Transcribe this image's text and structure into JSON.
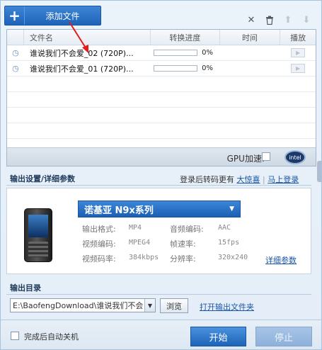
{
  "toolbar": {
    "add_file_label": "添加文件",
    "icons": [
      "close-icon",
      "trash-icon",
      "arrow-up-icon",
      "arrow-down-icon"
    ]
  },
  "file_list": {
    "headers": [
      "文件名",
      "转换进度",
      "时间",
      "播放"
    ],
    "rows": [
      {
        "name": "谁说我们不会爱_02 (720P)...",
        "progress": "0%",
        "progress_fraction": 0
      },
      {
        "name": "谁说我们不会爱_01 (720P)...",
        "progress": "0%",
        "progress_fraction": 0
      }
    ],
    "gpu_label": "GPU加速:",
    "gpu_checked": false,
    "intel_label": "intel"
  },
  "output_settings": {
    "title": "输出设置/详细参数",
    "login_note": "登录后转码更有",
    "surprise_link": "大惊喜",
    "login_link": "马上登录",
    "device_model": "诺基亚 N9x系列",
    "specs": [
      {
        "label": "输出格式:",
        "value": "MP4"
      },
      {
        "label": "音频编码:",
        "value": "AAC"
      },
      {
        "label": "视频编码:",
        "value": "MPEG4"
      },
      {
        "label": "帧速率:",
        "value": "15fps"
      },
      {
        "label": "视频码率:",
        "value": "384kbps"
      },
      {
        "label": "分辨率:",
        "value": "320x240"
      }
    ],
    "detail_link": "详细参数"
  },
  "output_dir": {
    "title": "输出目录",
    "path": "E:\\BaofengDownload\\谁说我们不会",
    "browse_label": "浏览",
    "open_folder_link": "打开输出文件夹"
  },
  "footer": {
    "auto_shutdown_label": "完成后自动关机",
    "start_label": "开始",
    "stop_label": "停止"
  }
}
